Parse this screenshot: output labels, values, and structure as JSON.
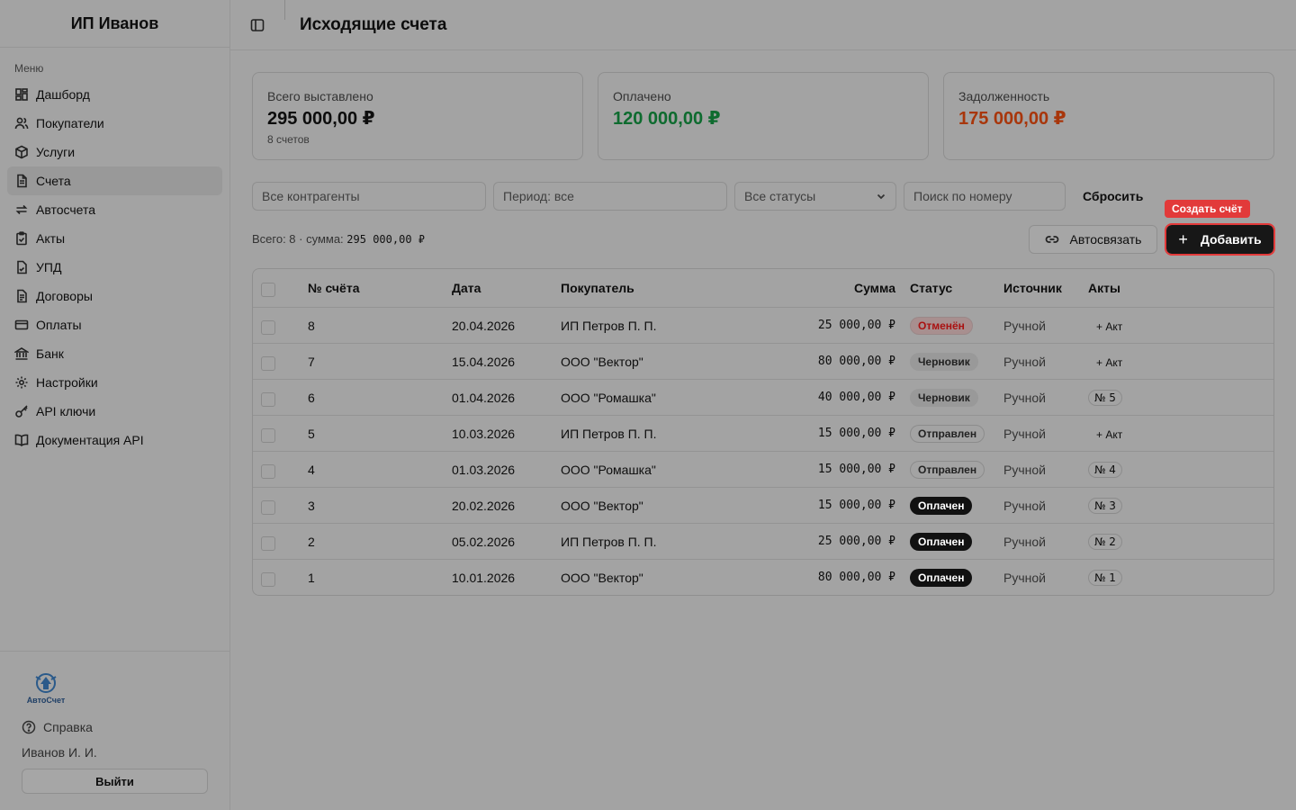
{
  "brand": "ИП Иванов",
  "menu_caption": "Меню",
  "nav": [
    {
      "label": "Дашборд",
      "icon": "dashboard-icon",
      "active": false
    },
    {
      "label": "Покупатели",
      "icon": "users-icon",
      "active": false
    },
    {
      "label": "Услуги",
      "icon": "box-icon",
      "active": false
    },
    {
      "label": "Счета",
      "icon": "document-icon",
      "active": true
    },
    {
      "label": "Автосчета",
      "icon": "repeat-icon",
      "active": false
    },
    {
      "label": "Акты",
      "icon": "clipboard-check-icon",
      "active": false
    },
    {
      "label": "УПД",
      "icon": "file-check-icon",
      "active": false
    },
    {
      "label": "Договоры",
      "icon": "file-text-icon",
      "active": false
    },
    {
      "label": "Оплаты",
      "icon": "credit-card-icon",
      "active": false
    },
    {
      "label": "Банк",
      "icon": "bank-icon",
      "active": false
    },
    {
      "label": "Настройки",
      "icon": "gear-icon",
      "active": false
    },
    {
      "label": "API ключи",
      "icon": "key-icon",
      "active": false
    },
    {
      "label": "Документация API",
      "icon": "book-icon",
      "active": false
    }
  ],
  "sidebar_bottom": {
    "logo_text": "АвтоСчет",
    "help": "Справка",
    "user": "Иванов И. И.",
    "logout": "Выйти"
  },
  "header": {
    "title": "Исходящие счета"
  },
  "cards": [
    {
      "label": "Всего выставлено",
      "value": "295 000,00 ₽",
      "sub": "8 счетов"
    },
    {
      "label": "Оплачено",
      "value": "120 000,00 ₽",
      "sub": ""
    },
    {
      "label": "Задолженность",
      "value": "175 000,00 ₽",
      "sub": ""
    }
  ],
  "filters": {
    "counterparty_placeholder": "Все контрагенты",
    "period_placeholder": "Период: все",
    "status_selected": "Все статусы",
    "search_placeholder": "Поиск по номеру",
    "reset": "Сбросить"
  },
  "summary": {
    "prefix": "Всего: 8 · сумма:",
    "sum": "295 000,00 ₽"
  },
  "actions": {
    "autolink": "Автосвязать",
    "add": "Добавить",
    "tooltip": "Создать счёт"
  },
  "table": {
    "columns": [
      "№ счёта",
      "Дата",
      "Покупатель",
      "Сумма",
      "Статус",
      "Источник",
      "Акты"
    ],
    "rows": [
      {
        "num": "8",
        "date": "20.04.2026",
        "buyer": "ИП Петров П. П.",
        "sum": "25 000,00 ₽",
        "status": "Отменён",
        "status_kind": "cancel",
        "source": "Ручной",
        "acts": "+ Акт",
        "acts_kind": "add"
      },
      {
        "num": "7",
        "date": "15.04.2026",
        "buyer": "ООО \"Вектор\"",
        "sum": "80 000,00 ₽",
        "status": "Черновик",
        "status_kind": "draft",
        "source": "Ручной",
        "acts": "+ Акт",
        "acts_kind": "add"
      },
      {
        "num": "6",
        "date": "01.04.2026",
        "buyer": "ООО \"Ромашка\"",
        "sum": "40 000,00 ₽",
        "status": "Черновик",
        "status_kind": "draft",
        "source": "Ручной",
        "acts": "№ 5",
        "acts_kind": "badge"
      },
      {
        "num": "5",
        "date": "10.03.2026",
        "buyer": "ИП Петров П. П.",
        "sum": "15 000,00 ₽",
        "status": "Отправлен",
        "status_kind": "sent",
        "source": "Ручной",
        "acts": "+ Акт",
        "acts_kind": "add"
      },
      {
        "num": "4",
        "date": "01.03.2026",
        "buyer": "ООО \"Ромашка\"",
        "sum": "15 000,00 ₽",
        "status": "Отправлен",
        "status_kind": "sent",
        "source": "Ручной",
        "acts": "№ 4",
        "acts_kind": "badge"
      },
      {
        "num": "3",
        "date": "20.02.2026",
        "buyer": "ООО \"Вектор\"",
        "sum": "15 000,00 ₽",
        "status": "Оплачен",
        "status_kind": "paid",
        "source": "Ручной",
        "acts": "№ 3",
        "acts_kind": "badge"
      },
      {
        "num": "2",
        "date": "05.02.2026",
        "buyer": "ИП Петров П. П.",
        "sum": "25 000,00 ₽",
        "status": "Оплачен",
        "status_kind": "paid",
        "source": "Ручной",
        "acts": "№ 2",
        "acts_kind": "badge"
      },
      {
        "num": "1",
        "date": "10.01.2026",
        "buyer": "ООО \"Вектор\"",
        "sum": "80 000,00 ₽",
        "status": "Оплачен",
        "status_kind": "paid",
        "source": "Ручной",
        "acts": "№ 1",
        "acts_kind": "badge"
      }
    ]
  },
  "colors": {
    "accent_red": "#e23a3a",
    "paid_green": "#0e6b2f",
    "debt_orange": "#a8360b"
  }
}
